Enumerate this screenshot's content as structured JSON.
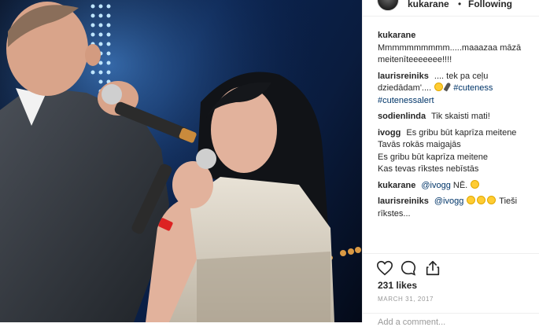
{
  "post": {
    "username": "kukarane",
    "separator": "•",
    "follow_status": "Following"
  },
  "comments": [
    {
      "user": "kukarane",
      "text": "Mmmmmmmmmm.....maaazaa māzā meitenīteeeeeee!!!!"
    },
    {
      "user": "laurisreiniks",
      "text": ".... tek pa ceļu dziedādam'....",
      "tags": [
        "#cuteness",
        "#cutenessalert"
      ]
    },
    {
      "user": "sodienlinda",
      "text": "Tik skaisti mati!"
    },
    {
      "user": "ivogg",
      "text": "Es gribu būt kaprīza meitene",
      "lines": [
        "Tavās rokās maigajās",
        "Es gribu būt kaprīza meitene",
        "Kas tevas rīkstes nebīstās"
      ]
    },
    {
      "user": "kukarane",
      "mention": "@ivogg",
      "text": "NĒ."
    },
    {
      "user": "laurisreiniks",
      "mention": "@ivogg",
      "text": "Tieši rīkstes..."
    }
  ],
  "actions": {
    "like_icon": "heart-icon",
    "comment_icon": "comment-bubble-icon",
    "share_icon": "share-icon"
  },
  "likes": "231 likes",
  "date": "MARCH 31, 2017",
  "add_comment_placeholder": "Add a comment...",
  "colors": {
    "link": "#003569",
    "muted": "#999999",
    "divider": "#efefef"
  }
}
